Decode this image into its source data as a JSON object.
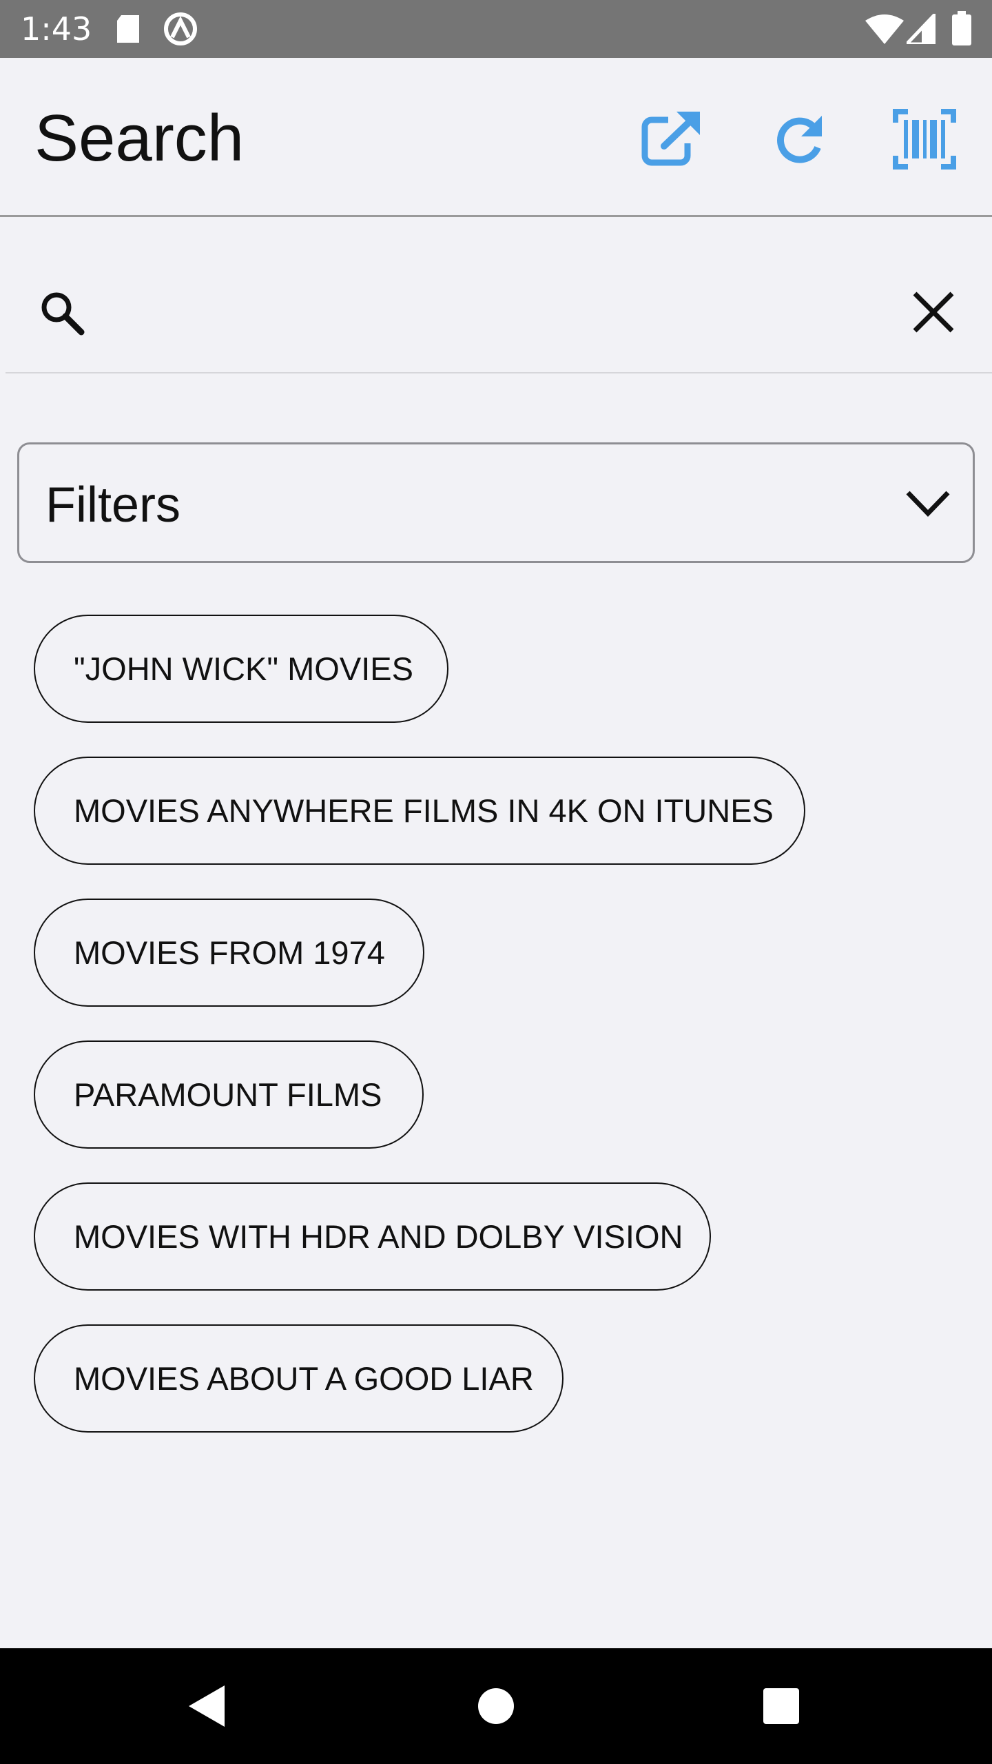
{
  "status_bar": {
    "time": "1:43",
    "icons": [
      "sd-card-icon",
      "sync-icon",
      "wifi-icon",
      "cellular-signal-icon",
      "battery-icon"
    ]
  },
  "header": {
    "title": "Search",
    "actions": [
      "open-external-icon",
      "refresh-icon",
      "barcode-scan-icon"
    ],
    "accent_color": "#4a9fe6"
  },
  "search": {
    "value": "",
    "placeholder": ""
  },
  "filters": {
    "label": "Filters"
  },
  "suggestions": [
    "\"JOHN WICK\" MOVIES",
    "MOVIES ANYWHERE FILMS IN 4K ON ITUNES",
    "MOVIES FROM 1974",
    "PARAMOUNT FILMS",
    "MOVIES WITH HDR AND DOLBY VISION",
    "MOVIES ABOUT A GOOD LIAR"
  ],
  "nav": {
    "buttons": [
      "back-icon",
      "home-icon",
      "recents-icon"
    ]
  }
}
